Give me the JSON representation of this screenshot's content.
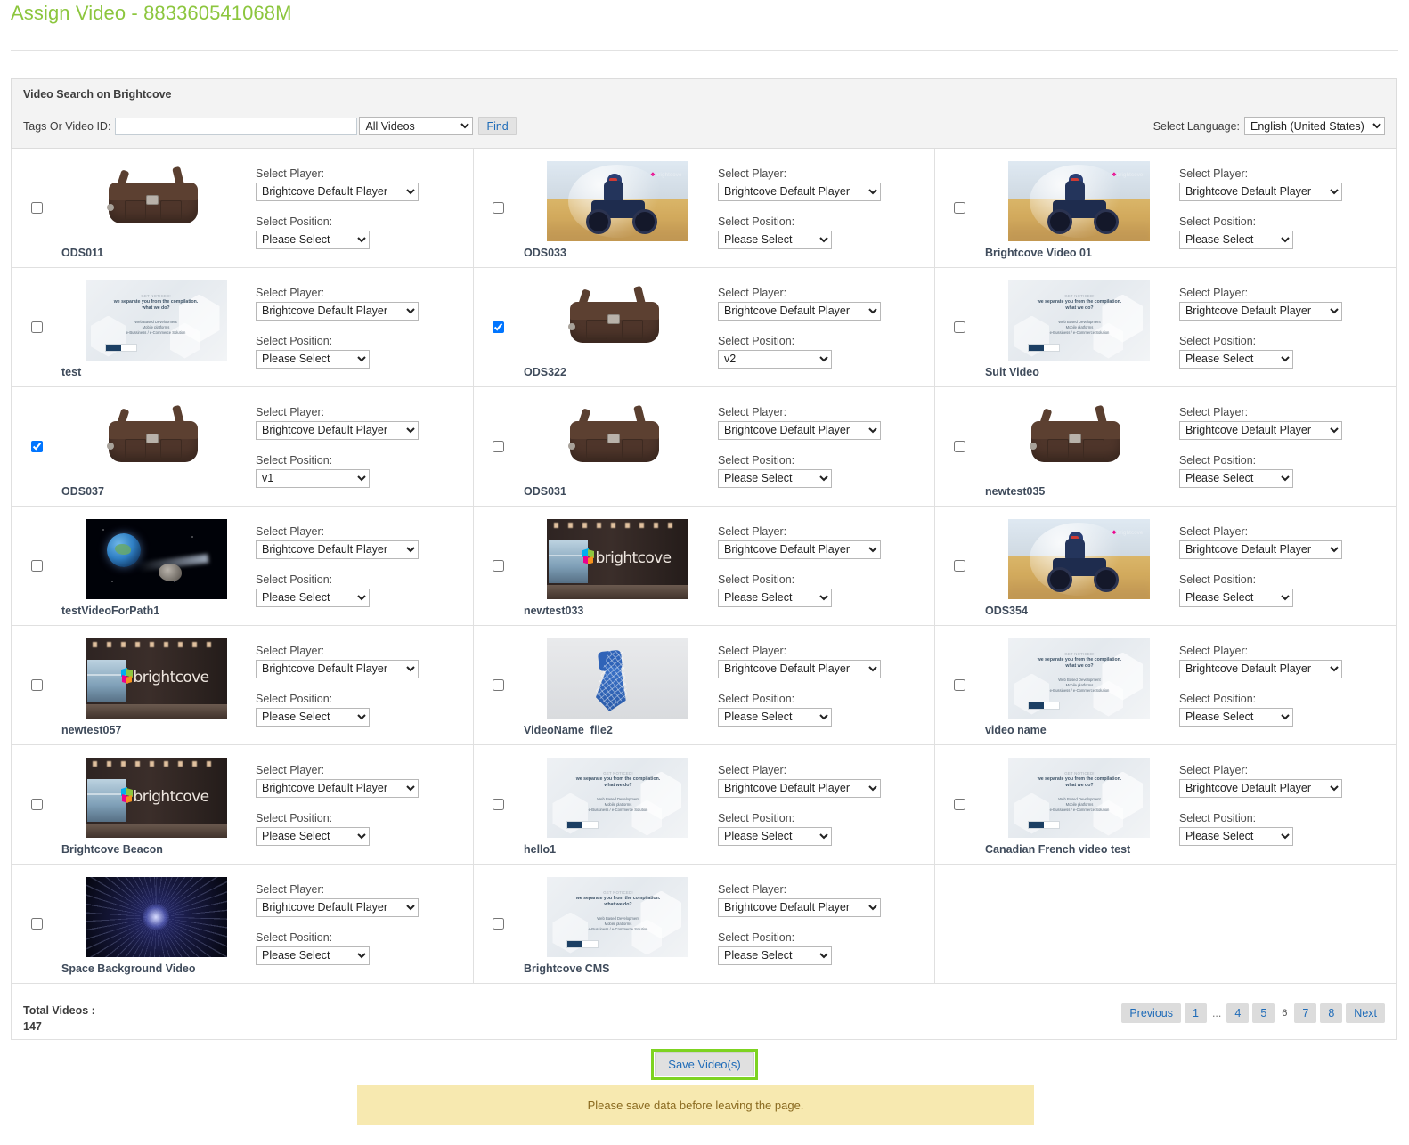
{
  "header": {
    "title": "Assign Video - 883360541068M",
    "title_color": "#8cc63e"
  },
  "search_panel": {
    "panel_title": "Video Search on Brightcove",
    "tags_label": "Tags Or Video ID:",
    "tags_value": "",
    "tags_placeholder": "",
    "scope_selected": "All Videos",
    "scope_options": [
      "All Videos"
    ],
    "find_label": "Find",
    "language_label": "Select Language:",
    "language_selected": "English (United States)",
    "language_options": [
      "English (United States)"
    ]
  },
  "labels": {
    "select_player": "Select Player:",
    "select_position": "Select Position:",
    "default_player": "Brightcove Default Player",
    "please_select": "Please Select"
  },
  "videos": [
    {
      "name": "ODS011",
      "art": "bag",
      "checked": false,
      "player": "Brightcove Default Player",
      "position": "Please Select"
    },
    {
      "name": "ODS033",
      "art": "quad",
      "checked": false,
      "player": "Brightcove Default Player",
      "position": "Please Select"
    },
    {
      "name": "Brightcove Video 01",
      "art": "quad",
      "checked": false,
      "player": "Brightcove Default Player",
      "position": "Please Select"
    },
    {
      "name": "test",
      "art": "slide",
      "checked": false,
      "player": "Brightcove Default Player",
      "position": "Please Select"
    },
    {
      "name": "ODS322",
      "art": "bag",
      "checked": true,
      "player": "Brightcove Default Player",
      "position": "v2"
    },
    {
      "name": "Suit Video",
      "art": "slide",
      "checked": false,
      "player": "Brightcove Default Player",
      "position": "Please Select"
    },
    {
      "name": "ODS037",
      "art": "bag",
      "checked": true,
      "player": "Brightcove Default Player",
      "position": "v1"
    },
    {
      "name": "ODS031",
      "art": "bag",
      "checked": false,
      "player": "Brightcove Default Player",
      "position": "Please Select"
    },
    {
      "name": "newtest035",
      "art": "bag",
      "checked": false,
      "player": "Brightcove Default Player",
      "position": "Please Select"
    },
    {
      "name": "testVideoForPath1",
      "art": "earth",
      "checked": false,
      "player": "Brightcove Default Player",
      "position": "Please Select"
    },
    {
      "name": "newtest033",
      "art": "office",
      "checked": false,
      "player": "Brightcove Default Player",
      "position": "Please Select"
    },
    {
      "name": "ODS354",
      "art": "quad",
      "checked": false,
      "player": "Brightcove Default Player",
      "position": "Please Select"
    },
    {
      "name": "newtest057",
      "art": "office",
      "checked": false,
      "player": "Brightcove Default Player",
      "position": "Please Select"
    },
    {
      "name": "VideoName_file2",
      "art": "tie",
      "checked": false,
      "player": "Brightcove Default Player",
      "position": "Please Select"
    },
    {
      "name": "video name",
      "art": "slide",
      "checked": false,
      "player": "Brightcove Default Player",
      "position": "Please Select"
    },
    {
      "name": "Brightcove Beacon",
      "art": "office",
      "checked": false,
      "player": "Brightcove Default Player",
      "position": "Please Select"
    },
    {
      "name": "hello1",
      "art": "slide",
      "checked": false,
      "player": "Brightcove Default Player",
      "position": "Please Select"
    },
    {
      "name": "Canadian French video test",
      "art": "slide",
      "checked": false,
      "player": "Brightcove Default Player",
      "position": "Please Select"
    },
    {
      "name": "Space Background Video",
      "art": "space",
      "checked": false,
      "player": "Brightcove Default Player",
      "position": "Please Select"
    },
    {
      "name": "Brightcove CMS",
      "art": "slide",
      "checked": false,
      "player": "Brightcove Default Player",
      "position": "Please Select"
    }
  ],
  "position_options": [
    "Please Select",
    "v1",
    "v2"
  ],
  "player_options": [
    "Brightcove Default Player"
  ],
  "thumb_slide_text": {
    "line1": "GET NOTICED!",
    "line2": "we separate you from the compilation.\nwhat we do?",
    "line3": "Web Based Development\nMobile platforms\ne-Bussiness / e-Commerce Solution"
  },
  "footer": {
    "total_label": "Total Videos :",
    "total_value": "147",
    "pagination": {
      "previous": "Previous",
      "next": "Next",
      "gap": "...",
      "pages": [
        "1",
        "4",
        "5",
        "6",
        "7",
        "8"
      ],
      "current": "6"
    },
    "save_label": "Save Video(s)",
    "warning": "Please save data before leaving the page.",
    "save_highlight_color": "#7dd321",
    "warning_bg": "#f7e9b0"
  }
}
